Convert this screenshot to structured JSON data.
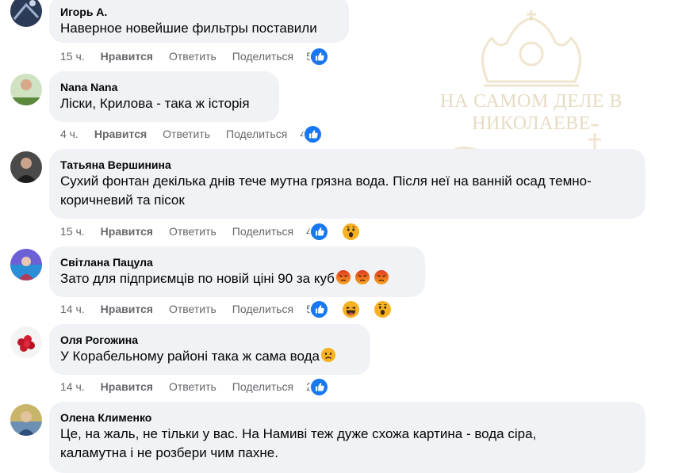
{
  "watermark": {
    "line1": "НА САМОМ ДЕЛЕ В",
    "line2": "НИКОЛАЕВЕ"
  },
  "colors": {
    "bubble": "#f0f2f5",
    "meta": "#65676b",
    "like_blue": "#1877f2",
    "wow_yellow": "#f7b125",
    "angry_orange": "#e9710f"
  },
  "comments": [
    {
      "author": "Игорь А.",
      "text": "Наверное новейшие фильтры поставили",
      "time": "15 ч.",
      "like_label": "Нравится",
      "reply_label": "Ответить",
      "share_label": "Поделиться",
      "reaction_count": "5",
      "reactions": [
        "like-icon"
      ]
    },
    {
      "author": "Nana Nana",
      "text": "Ліски, Крилова - така ж історія",
      "time": "4 ч.",
      "like_label": "Нравится",
      "reply_label": "Ответить",
      "share_label": "Поделиться",
      "reaction_count": "4",
      "reactions": [
        "like-icon"
      ]
    },
    {
      "author": "Татьяна Вершинина",
      "text_line1": "Сухий фонтан декілька днів тече мутна грязна вода. Після неї на ванній осад темно-",
      "text_line2": "коричневий та пісок",
      "time": "15 ч.",
      "like_label": "Нравится",
      "reply_label": "Ответить",
      "share_label": "Поделиться",
      "reaction_count": "4",
      "reactions": [
        "like-icon",
        "wow-icon"
      ]
    },
    {
      "author": "Світлана Пацула",
      "text": "Зато для підприємців по новій ціні 90 за куб",
      "text_emojis": [
        "angry-emoji",
        "angry-emoji",
        "angry-emoji"
      ],
      "time": "14 ч.",
      "like_label": "Нравится",
      "reply_label": "Ответить",
      "share_label": "Поделиться",
      "reaction_count": "5",
      "reactions": [
        "like-icon",
        "haha-icon",
        "wow-icon"
      ]
    },
    {
      "author": "Оля Рогожина",
      "text": "У Корабельному районі така ж сама вода",
      "text_emojis": [
        "frown-emoji"
      ],
      "time": "14 ч.",
      "like_label": "Нравится",
      "reply_label": "Ответить",
      "share_label": "Поделиться",
      "reaction_count": "2",
      "reactions": [
        "like-icon"
      ]
    },
    {
      "author": "Олена Клименко",
      "text_line1": "Це, на жаль, не тільки у вас. На Намиві теж дуже схожа картина - вода сіра,",
      "text_line2": "каламутна і не розбери чим пахне."
    }
  ]
}
